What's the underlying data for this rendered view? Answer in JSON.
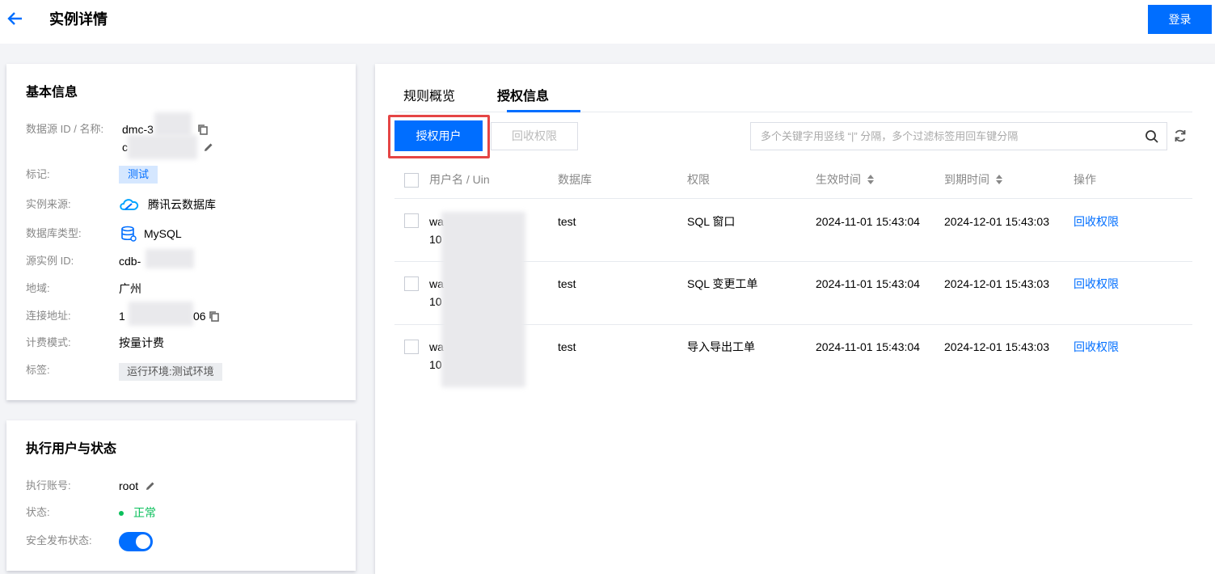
{
  "header": {
    "title": "实例详情",
    "login_label": "登录"
  },
  "basic_info": {
    "title": "基本信息",
    "datasource_label": "数据源 ID / 名称:",
    "datasource_id": "dmc-3",
    "datasource_name": "c",
    "mark_label": "标记:",
    "mark_tag": "测试",
    "source_label": "实例来源:",
    "source_value": "腾讯云数据库",
    "dbtype_label": "数据库类型:",
    "dbtype_value": "MySQL",
    "instance_label": "源实例 ID:",
    "instance_value": "cdb-",
    "region_label": "地域:",
    "region_value": "广州",
    "address_label": "连接地址:",
    "address_prefix": "1",
    "address_suffix": "06",
    "billing_label": "计费模式:",
    "billing_value": "按量计费",
    "tags_label": "标签:",
    "tags_value": "运行环境:测试环境"
  },
  "exec": {
    "title": "执行用户与状态",
    "account_label": "执行账号:",
    "account_value": "root",
    "status_label": "状态:",
    "status_value": "正常",
    "safe_label": "安全发布状态:",
    "safe_enabled": true
  },
  "tabs": [
    {
      "label": "规则概览",
      "active": false
    },
    {
      "label": "授权信息",
      "active": true
    }
  ],
  "toolbar": {
    "grant_label": "授权用户",
    "revoke_label": "回收权限",
    "search_placeholder": "多个关键字用竖线 “|” 分隔，多个过滤标签用回车键分隔"
  },
  "table": {
    "columns": [
      "用户名 / Uin",
      "数据库",
      "权限",
      "生效时间",
      "到期时间",
      "操作"
    ],
    "rows": [
      {
        "user_line1": "wa",
        "user_line2": "10",
        "database": "test",
        "permission": "SQL 窗口",
        "effective": "2024-11-01 15:43:04",
        "expire": "2024-12-01 15:43:03",
        "action": "回收权限"
      },
      {
        "user_line1": "wa",
        "user_line2": "10",
        "database": "test",
        "permission": "SQL 变更工单",
        "effective": "2024-11-01 15:43:04",
        "expire": "2024-12-01 15:43:03",
        "action": "回收权限"
      },
      {
        "user_line1": "wa",
        "user_line2": "10",
        "database": "test",
        "permission": "导入导出工单",
        "effective": "2024-11-01 15:43:04",
        "expire": "2024-12-01 15:43:03",
        "action": "回收权限"
      }
    ]
  },
  "colors": {
    "primary": "#006eff",
    "success": "#0abf5b",
    "highlight": "#e54545"
  }
}
